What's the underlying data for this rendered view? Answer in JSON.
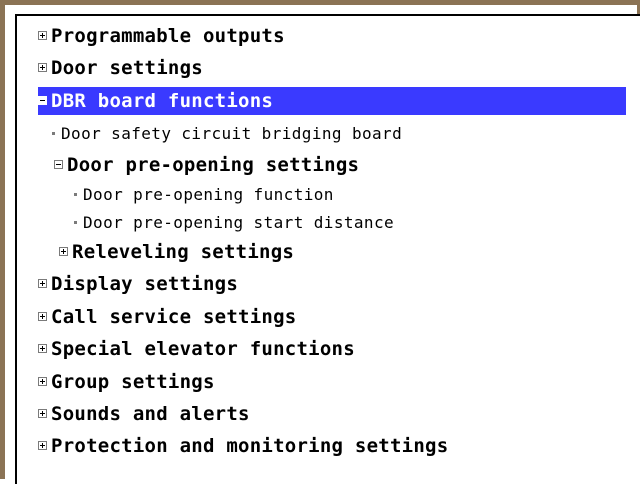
{
  "tree": {
    "items": [
      {
        "label": "Programmable outputs",
        "kind": "category",
        "state": "collapsed",
        "icon": "expand-plus-icon",
        "selected": false
      },
      {
        "label": "Door settings",
        "kind": "category",
        "state": "collapsed",
        "icon": "expand-plus-icon",
        "selected": false
      },
      {
        "label": "DBR board functions",
        "kind": "category",
        "state": "expanded",
        "icon": "collapse-minus-icon",
        "selected": true
      },
      {
        "label": "Door safety circuit bridging board",
        "kind": "leaf",
        "icon": "bullet-icon"
      },
      {
        "label": "Door pre-opening settings",
        "kind": "category",
        "state": "expanded",
        "icon": "collapse-minus-icon",
        "selected": false
      },
      {
        "label": "Door pre-opening function",
        "kind": "leaf",
        "icon": "bullet-icon"
      },
      {
        "label": "Door pre-opening start distance",
        "kind": "leaf",
        "icon": "bullet-icon"
      },
      {
        "label": "Releveling settings",
        "kind": "category",
        "state": "collapsed",
        "icon": "expand-plus-icon",
        "selected": false
      },
      {
        "label": "Display settings",
        "kind": "category",
        "state": "collapsed",
        "icon": "expand-plus-icon",
        "selected": false
      },
      {
        "label": "Call service settings",
        "kind": "category",
        "state": "collapsed",
        "icon": "expand-plus-icon",
        "selected": false
      },
      {
        "label": "Special elevator functions",
        "kind": "category",
        "state": "collapsed",
        "icon": "expand-plus-icon",
        "selected": false
      },
      {
        "label": "Group settings",
        "kind": "category",
        "state": "collapsed",
        "icon": "expand-plus-icon",
        "selected": false
      },
      {
        "label": "Sounds and alerts",
        "kind": "category",
        "state": "collapsed",
        "icon": "expand-plus-icon",
        "selected": false
      },
      {
        "label": "Protection and monitoring settings",
        "kind": "category",
        "state": "collapsed",
        "icon": "expand-plus-icon",
        "selected": false
      }
    ]
  },
  "colors": {
    "selection": "#3a3aff",
    "frame": "#8b7355",
    "text": "#000000"
  }
}
